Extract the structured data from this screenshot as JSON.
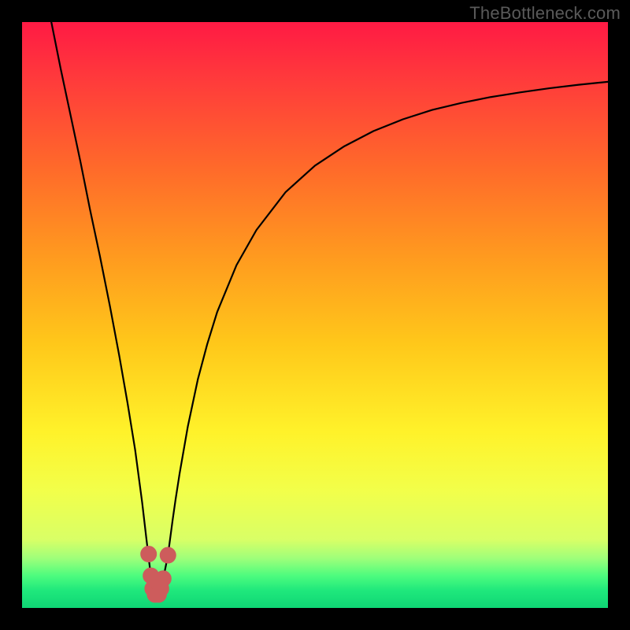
{
  "watermark": "TheBottleneck.com",
  "colors": {
    "frame": "#000000",
    "curve": "#000000",
    "marker_fill": "#cd5c5c",
    "marker_stroke": "#cd5c5c",
    "gradient_stops": [
      {
        "offset": 0.0,
        "color": "#ff1a44"
      },
      {
        "offset": 0.1,
        "color": "#ff3b3b"
      },
      {
        "offset": 0.25,
        "color": "#ff6a2a"
      },
      {
        "offset": 0.4,
        "color": "#ff9a1f"
      },
      {
        "offset": 0.55,
        "color": "#ffc81a"
      },
      {
        "offset": 0.7,
        "color": "#fff22a"
      },
      {
        "offset": 0.8,
        "color": "#f2ff4a"
      },
      {
        "offset": 0.883,
        "color": "#d9ff66"
      },
      {
        "offset": 0.915,
        "color": "#9fff7a"
      },
      {
        "offset": 0.945,
        "color": "#4dfc7e"
      },
      {
        "offset": 0.97,
        "color": "#1fe87c"
      },
      {
        "offset": 1.0,
        "color": "#0fd675"
      }
    ]
  },
  "chart_data": {
    "type": "line",
    "title": "",
    "xlabel": "",
    "ylabel": "",
    "xlim": [
      0,
      100
    ],
    "ylim": [
      0,
      100
    ],
    "series": [
      {
        "name": "curve",
        "x": [
          5.0,
          6.6,
          8.3,
          10.0,
          11.6,
          13.3,
          15.0,
          16.6,
          18.0,
          19.3,
          20.5,
          21.2,
          21.8,
          22.2,
          22.7,
          23.3,
          23.9,
          24.9,
          25.7,
          26.2,
          26.9,
          28.3,
          30.0,
          31.6,
          33.3,
          36.6,
          40.0,
          45.0,
          50.0,
          55.0,
          60.0,
          65.0,
          70.0,
          75.0,
          80.0,
          85.0,
          90.0,
          95.0,
          100.0
        ],
        "y": [
          100.0,
          92.0,
          84.0,
          76.0,
          68.0,
          60.0,
          51.5,
          43.0,
          35.0,
          27.0,
          18.0,
          12.0,
          7.0,
          4.0,
          2.3,
          2.3,
          4.0,
          9.0,
          15.0,
          18.5,
          23.0,
          31.0,
          39.0,
          45.0,
          50.5,
          58.5,
          64.5,
          71.0,
          75.5,
          78.8,
          81.4,
          83.4,
          85.0,
          86.2,
          87.2,
          88.0,
          88.7,
          89.3,
          89.8
        ]
      }
    ],
    "markers": [
      {
        "x": 21.6,
        "y": 9.2
      },
      {
        "x": 22.0,
        "y": 5.5
      },
      {
        "x": 22.3,
        "y": 3.3
      },
      {
        "x": 22.7,
        "y": 2.3
      },
      {
        "x": 23.3,
        "y": 2.3
      },
      {
        "x": 23.7,
        "y": 3.3
      },
      {
        "x": 24.1,
        "y": 5.0
      },
      {
        "x": 24.9,
        "y": 9.0
      }
    ],
    "marker_radius_px": 10
  }
}
